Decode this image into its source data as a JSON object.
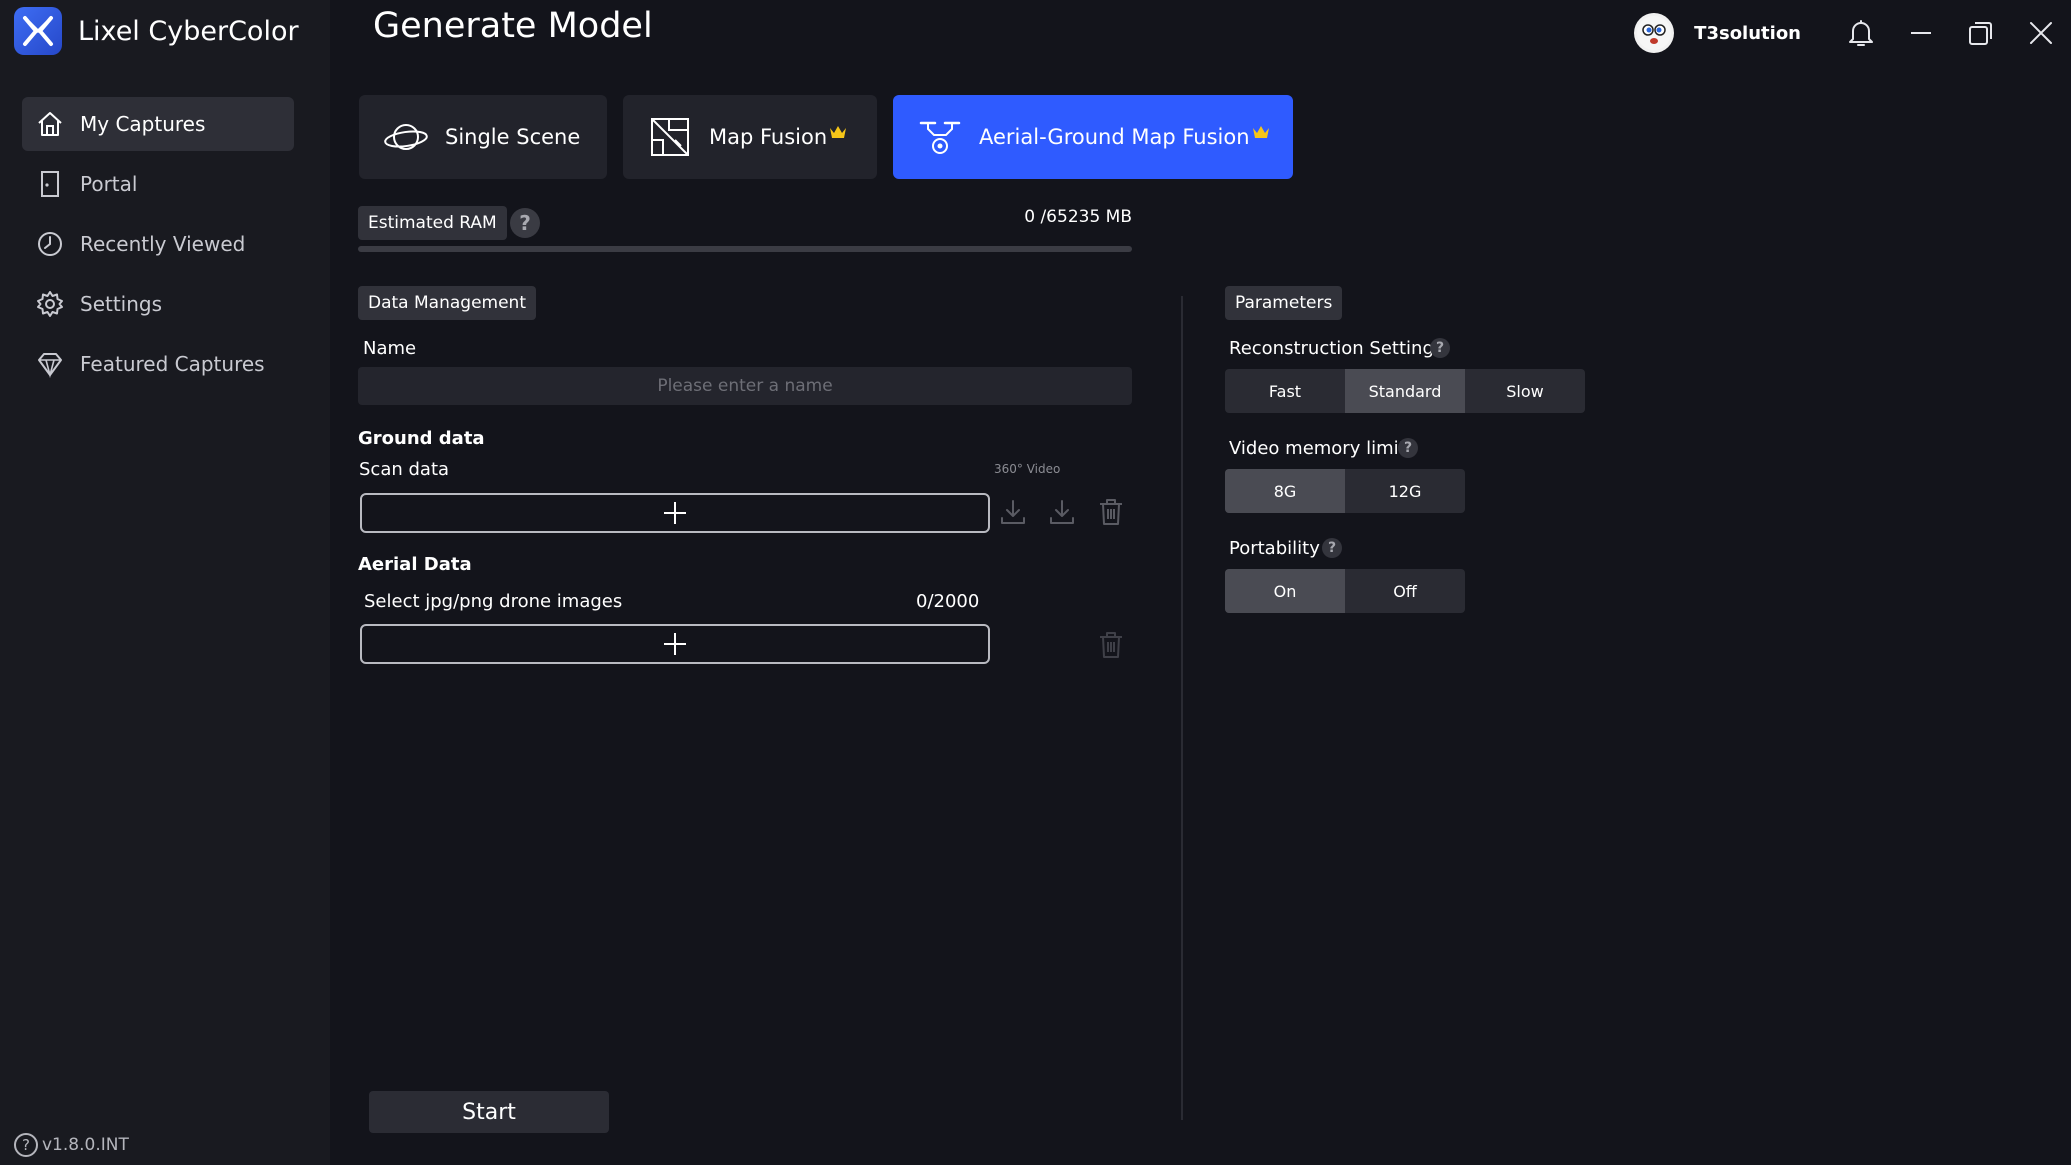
{
  "app": {
    "name": "Lixel CyberColor",
    "version": "v1.8.0.INT"
  },
  "sidebar": {
    "items": [
      {
        "label": "My Captures",
        "icon": "home-icon",
        "active": true
      },
      {
        "label": "Portal",
        "icon": "door-icon",
        "active": false
      },
      {
        "label": "Recently Viewed",
        "icon": "clock-icon",
        "active": false
      },
      {
        "label": "Settings",
        "icon": "gear-icon",
        "active": false
      },
      {
        "label": "Featured Captures",
        "icon": "diamond-icon",
        "active": false
      }
    ]
  },
  "header": {
    "title": "Generate Model",
    "username": "T3solution"
  },
  "tabs": [
    {
      "label": "Single Scene",
      "icon": "planet-icon",
      "premium": false,
      "active": false
    },
    {
      "label": "Map Fusion",
      "icon": "map-fusion-icon",
      "premium": true,
      "active": false
    },
    {
      "label": "Aerial-Ground Map Fusion",
      "icon": "drone-icon",
      "premium": true,
      "active": true
    }
  ],
  "ram": {
    "label": "Estimated RAM",
    "value_text": "0 /65235 MB",
    "used_fraction": 0
  },
  "data_management": {
    "section_label": "Data Management",
    "name_label": "Name",
    "name_placeholder": "Please enter a name",
    "name_value": "",
    "ground_data_label": "Ground data",
    "scan_data_label": "Scan data",
    "video_caption": "360° Video",
    "aerial_data_label": "Aerial Data",
    "drone_images_label": "Select jpg/png drone images",
    "drone_images_count": "0/2000"
  },
  "parameters": {
    "section_label": "Parameters",
    "reconstruction": {
      "label": "Reconstruction Settings",
      "options": [
        "Fast",
        "Standard",
        "Slow"
      ],
      "selected": "Standard"
    },
    "video_memory": {
      "label": "Video memory limit",
      "options": [
        "8G",
        "12G"
      ],
      "selected": "8G"
    },
    "portability": {
      "label": "Portability",
      "options": [
        "On",
        "Off"
      ],
      "selected": "On"
    }
  },
  "start_label": "Start",
  "colors": {
    "accent": "#2f5bff",
    "background": "#13141b",
    "sidebar": "#191a20",
    "crown": "#f5c518"
  }
}
